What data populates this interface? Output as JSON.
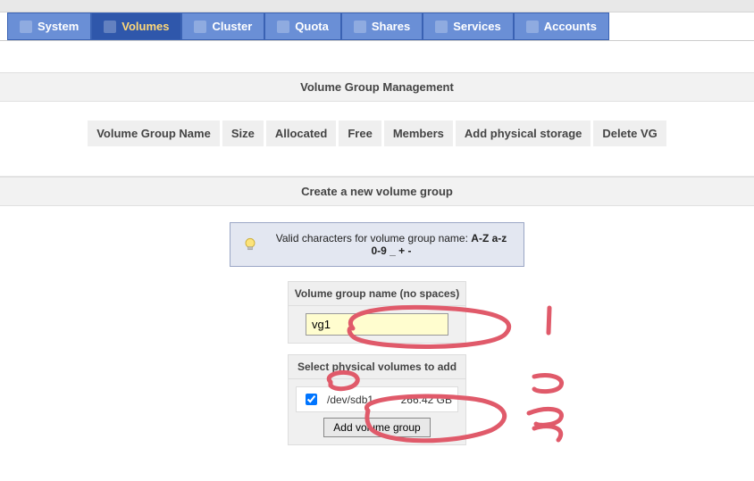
{
  "nav": [
    {
      "label": "System",
      "icon": "system-icon"
    },
    {
      "label": "Volumes",
      "icon": "volumes-icon",
      "active": true
    },
    {
      "label": "Cluster",
      "icon": "cluster-icon"
    },
    {
      "label": "Quota",
      "icon": "quota-icon"
    },
    {
      "label": "Shares",
      "icon": "shares-icon"
    },
    {
      "label": "Services",
      "icon": "services-icon"
    },
    {
      "label": "Accounts",
      "icon": "accounts-icon"
    }
  ],
  "sections": {
    "vg_mgmt_title": "Volume Group Management",
    "create_title": "Create a new volume group"
  },
  "vg_table_headers": [
    "Volume Group Name",
    "Size",
    "Allocated",
    "Free",
    "Members",
    "Add physical storage",
    "Delete VG"
  ],
  "hint": {
    "prefix": "Valid characters for volume group name: ",
    "bold": "A-Z a-z 0-9 _ + -"
  },
  "form": {
    "name_label": "Volume group name (no spaces)",
    "name_value": "vg1",
    "select_label": "Select physical volumes to add",
    "pv": {
      "device": "/dev/sdb1",
      "size": "266.42 GB",
      "checked": true
    },
    "submit_label": "Add volume group"
  },
  "annotations": [
    "1",
    "2",
    "3"
  ]
}
